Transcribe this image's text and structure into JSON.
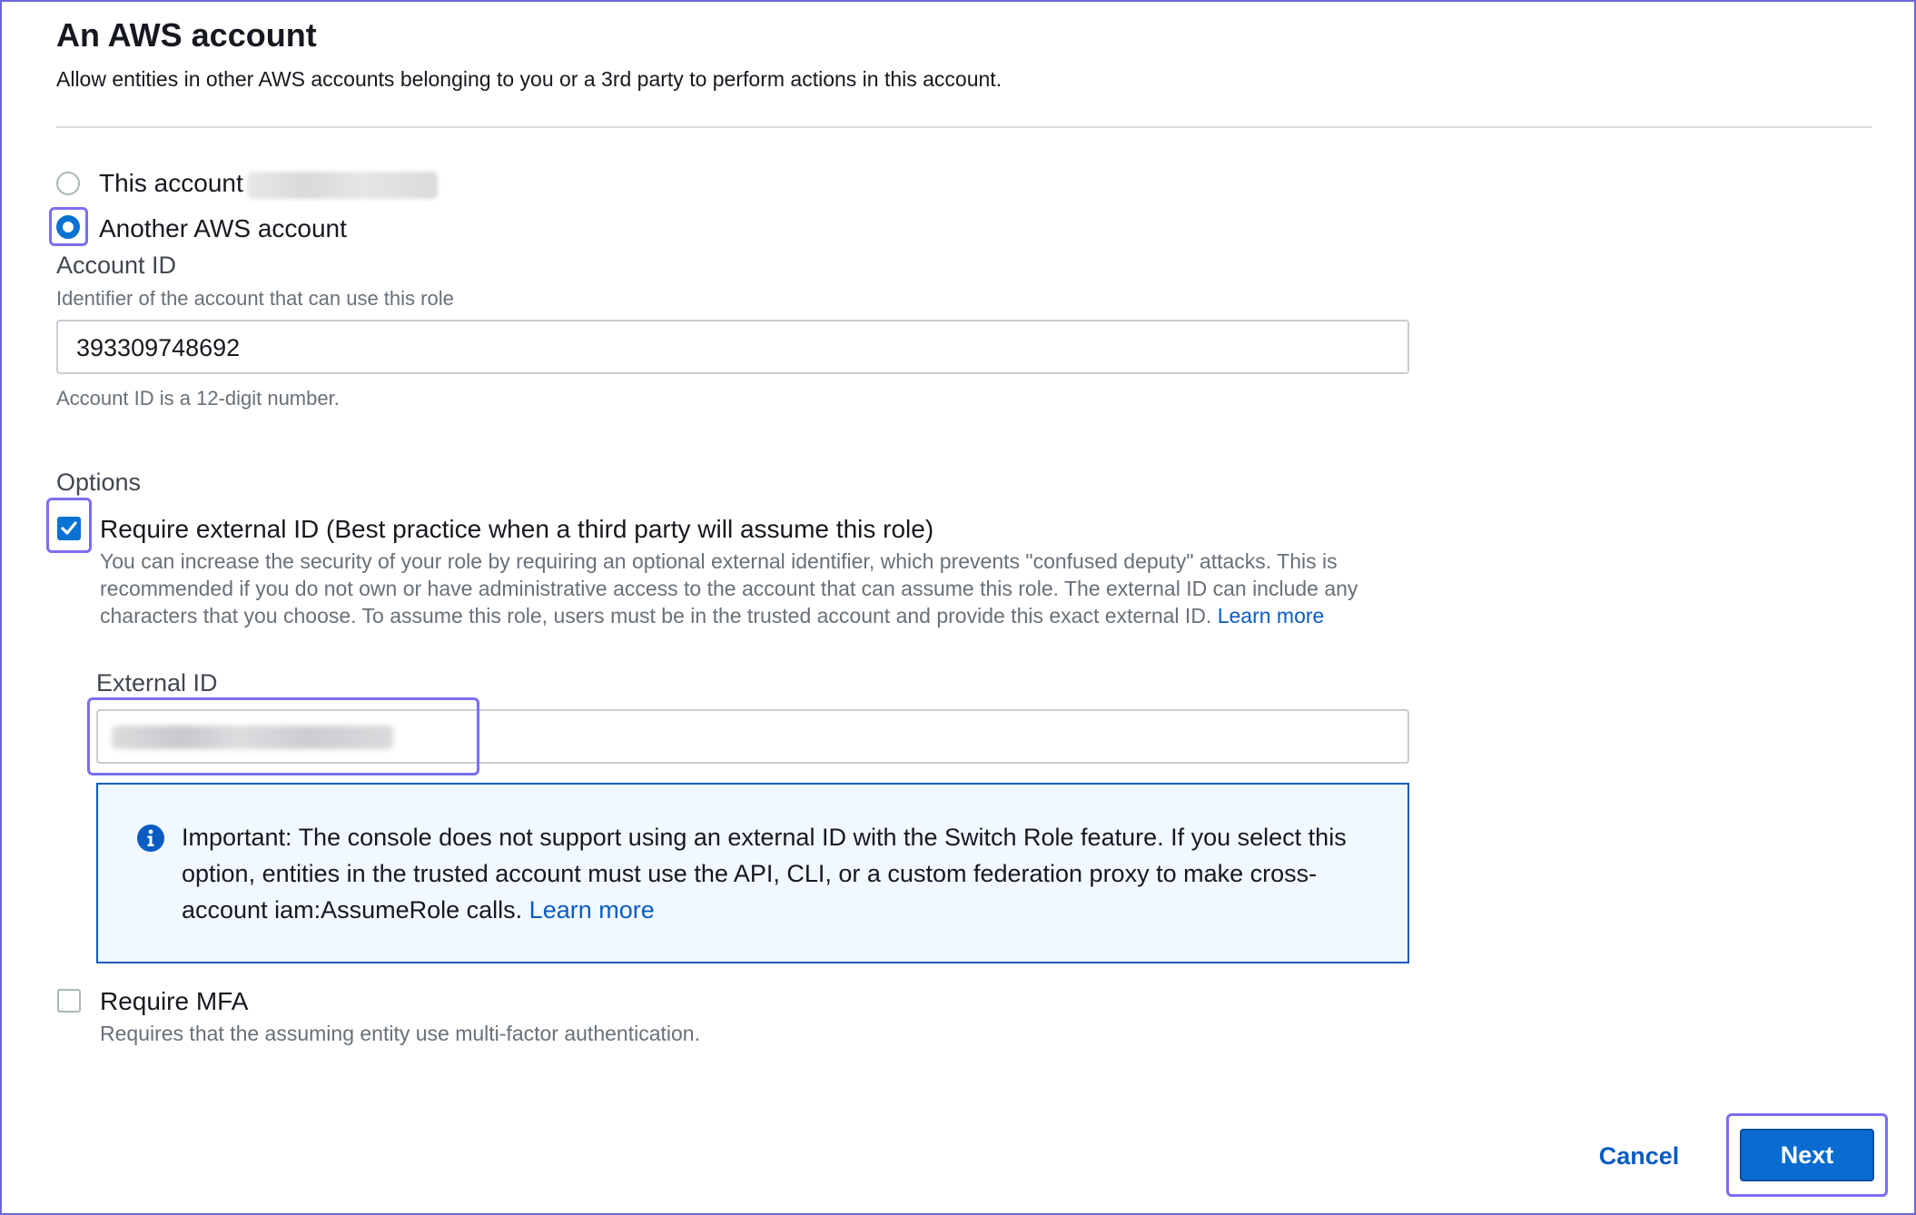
{
  "header": {
    "title": "An AWS account",
    "subtitle": "Allow entities in other AWS accounts belonging to you or a 3rd party to perform actions in this account."
  },
  "trust": {
    "this_account_label": "This account",
    "this_account_selected": false,
    "another_account_label": "Another AWS account",
    "another_account_selected": true
  },
  "account_id": {
    "label": "Account ID",
    "description": "Identifier of the account that can use this role",
    "value": "393309748692",
    "constraint": "Account ID is a 12-digit number."
  },
  "options": {
    "heading": "Options",
    "external_id": {
      "label": "Require external ID (Best practice when a third party will assume this role)",
      "checked": true,
      "description": "You can increase the security of your role by requiring an optional external identifier, which prevents \"confused deputy\" attacks. This is recommended if you do not own or have administrative access to the account that can assume this role. The external ID can include any characters that you choose. To assume this role, users must be in the trusted account and provide this exact external ID.",
      "learn_more": "Learn more",
      "field_label": "External ID",
      "field_icon": "info-icon"
    },
    "info_alert": {
      "text": "Important: The console does not support using an external ID with the Switch Role feature. If you select this option, entities in the trusted account must use the API, CLI, or a custom federation proxy to make cross-account iam:AssumeRole calls.",
      "learn_more": "Learn more"
    },
    "mfa": {
      "label": "Require MFA",
      "checked": false,
      "description": "Requires that the assuming entity use multi-factor authentication."
    }
  },
  "footer": {
    "cancel_label": "Cancel",
    "next_label": "Next"
  },
  "colors": {
    "primary": "#0972d3",
    "link": "#0a5cc2",
    "highlight": "#7b6ef0",
    "info_bg": "#f1f8ff"
  }
}
